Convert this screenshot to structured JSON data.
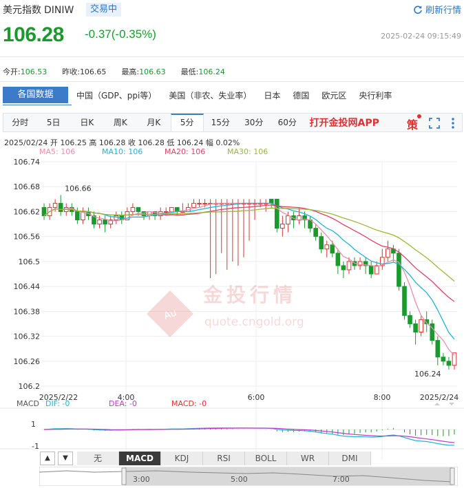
{
  "header": {
    "title": "美元指数",
    "code": "DINIW",
    "status_badge": "交易中",
    "refresh_label": "刷新行情",
    "price": "106.28",
    "change": "-0.37(-0.35%)",
    "timestamp": "2025-02-24 09:15:49"
  },
  "stats": [
    {
      "label": "今开:",
      "value": "106.53",
      "color": "g"
    },
    {
      "label": "昨收:",
      "value": "106.65",
      "color": ""
    },
    {
      "label": "最高:",
      "value": "106.63",
      "color": "g"
    },
    {
      "label": "最低:",
      "value": "106.24",
      "color": "g"
    }
  ],
  "data_tabs": {
    "active": "各国数据",
    "items": [
      "中国（GDP、ppi等）",
      "美国（非农、失业率）",
      "日本",
      "德国",
      "欧元区",
      "央行利率"
    ]
  },
  "periods": [
    "分时",
    "5日",
    "日K",
    "周K",
    "月K",
    "5分",
    "15分",
    "30分",
    "60分"
  ],
  "active_period": "5分",
  "app_link": "打开金投网APP",
  "ohlc_line": "2025/02/24  开 106.25  高 106.28  收 106.28  低 106.24  幅 0.02%",
  "ma_labels": [
    {
      "text": "MA5: 106",
      "color": "#f08cac"
    },
    {
      "text": "MA10: 106",
      "color": "#1fb4d6"
    },
    {
      "text": "MA20: 106",
      "color": "#e0406a"
    },
    {
      "text": "MA30: 106",
      "color": "#99b83a"
    }
  ],
  "watermark": {
    "brand": "金投行情",
    "url": "quote.cngold.org",
    "logo": "Au"
  },
  "macd_line": {
    "label": "MACD",
    "dif": "DIF: -0",
    "dea": "DEA: -0",
    "macd": "MACD: -0"
  },
  "indicator_tabs": [
    "无",
    "MACD",
    "KDJ",
    "RSI",
    "BOLL",
    "WR",
    "DMI"
  ],
  "active_indicator": "MACD",
  "navigator_times": [
    "3:00",
    "5:00",
    "7:00"
  ],
  "colors": {
    "up": "#e03030",
    "down": "#1a9a2e",
    "accent": "#3b7bc9"
  },
  "chart_data": {
    "type": "candlestick",
    "y_ticks": [
      "106.74",
      "106.68",
      "106.62",
      "106.56",
      "106.5",
      "106.44",
      "106.38",
      "106.32",
      "106.26",
      "106.2"
    ],
    "ylim": [
      106.2,
      106.74
    ],
    "x_tick_labels": [
      "2025/2/22",
      "4:00",
      "6:00",
      "8:00",
      "2025/2/24"
    ],
    "annotations": {
      "high": "106.66",
      "low": "106.24"
    },
    "candles": [
      [
        106.63,
        106.61,
        106.64,
        106.6
      ],
      [
        106.61,
        106.63,
        106.64,
        106.6
      ],
      [
        106.63,
        106.64,
        106.65,
        106.62
      ],
      [
        106.64,
        106.62,
        106.66,
        106.61
      ],
      [
        106.62,
        106.63,
        106.64,
        106.61
      ],
      [
        106.63,
        106.62,
        106.64,
        106.61
      ],
      [
        106.62,
        106.6,
        106.63,
        106.59
      ],
      [
        106.6,
        106.62,
        106.63,
        106.59
      ],
      [
        106.62,
        106.61,
        106.63,
        106.6
      ],
      [
        106.61,
        106.59,
        106.62,
        106.58
      ],
      [
        106.59,
        106.6,
        106.61,
        106.58
      ],
      [
        106.6,
        106.59,
        106.61,
        106.57
      ],
      [
        106.59,
        106.6,
        106.61,
        106.58
      ],
      [
        106.6,
        106.61,
        106.62,
        106.59
      ],
      [
        106.61,
        106.6,
        106.62,
        106.59
      ],
      [
        106.6,
        106.62,
        106.63,
        106.6
      ],
      [
        106.62,
        106.63,
        106.64,
        106.61
      ],
      [
        106.63,
        106.62,
        106.63,
        106.61
      ],
      [
        106.62,
        106.61,
        106.62,
        106.6
      ],
      [
        106.61,
        106.62,
        106.62,
        106.6
      ],
      [
        106.62,
        106.61,
        106.62,
        106.6
      ],
      [
        106.61,
        106.62,
        106.63,
        106.6
      ],
      [
        106.62,
        106.62,
        106.63,
        106.61
      ],
      [
        106.62,
        106.63,
        106.63,
        106.62
      ],
      [
        106.63,
        106.62,
        106.63,
        106.61
      ],
      [
        106.62,
        106.62,
        106.64,
        106.62
      ],
      [
        106.62,
        106.63,
        106.64,
        106.62
      ],
      [
        106.63,
        106.64,
        106.65,
        106.63
      ],
      [
        106.64,
        106.64,
        106.65,
        106.63
      ],
      [
        106.64,
        106.64,
        106.65,
        106.63
      ],
      [
        106.64,
        106.64,
        106.65,
        106.46
      ],
      [
        106.64,
        106.64,
        106.65,
        106.47
      ],
      [
        106.64,
        106.64,
        106.65,
        106.52
      ],
      [
        106.64,
        106.64,
        106.65,
        106.48
      ],
      [
        106.64,
        106.64,
        106.65,
        106.5
      ],
      [
        106.64,
        106.64,
        106.65,
        106.49
      ],
      [
        106.64,
        106.64,
        106.65,
        106.51
      ],
      [
        106.64,
        106.64,
        106.65,
        106.55
      ],
      [
        106.64,
        106.64,
        106.65,
        106.6
      ],
      [
        106.64,
        106.64,
        106.65,
        106.63
      ],
      [
        106.64,
        106.64,
        106.65,
        106.62
      ],
      [
        106.65,
        106.64,
        106.65,
        106.63
      ],
      [
        106.65,
        106.58,
        106.65,
        106.57
      ],
      [
        106.58,
        106.59,
        106.61,
        106.56
      ],
      [
        106.59,
        106.61,
        106.62,
        106.57
      ],
      [
        106.61,
        106.6,
        106.62,
        106.58
      ],
      [
        106.6,
        106.61,
        106.63,
        106.59
      ],
      [
        106.61,
        106.6,
        106.62,
        106.58
      ],
      [
        106.6,
        106.58,
        106.61,
        106.57
      ],
      [
        106.58,
        106.56,
        106.59,
        106.55
      ],
      [
        106.56,
        106.53,
        106.57,
        106.52
      ],
      [
        106.53,
        106.54,
        106.55,
        106.51
      ],
      [
        106.54,
        106.52,
        106.55,
        106.51
      ],
      [
        106.52,
        106.49,
        106.53,
        106.47
      ],
      [
        106.49,
        106.48,
        106.5,
        106.46
      ],
      [
        106.48,
        106.5,
        106.51,
        106.47
      ],
      [
        106.5,
        106.49,
        106.51,
        106.48
      ],
      [
        106.49,
        106.5,
        106.51,
        106.48
      ],
      [
        106.5,
        106.49,
        106.51,
        106.47
      ],
      [
        106.49,
        106.47,
        106.5,
        106.46
      ],
      [
        106.47,
        106.49,
        106.5,
        106.47
      ],
      [
        106.49,
        106.51,
        106.53,
        106.48
      ],
      [
        106.51,
        106.53,
        106.55,
        106.5
      ],
      [
        106.53,
        106.52,
        106.54,
        106.5
      ],
      [
        106.52,
        106.44,
        106.53,
        106.43
      ],
      [
        106.44,
        106.37,
        106.45,
        106.36
      ],
      [
        106.37,
        106.35,
        106.38,
        106.34
      ],
      [
        106.35,
        106.33,
        106.36,
        106.3
      ],
      [
        106.33,
        106.36,
        106.37,
        106.32
      ],
      [
        106.36,
        106.35,
        106.38,
        106.33
      ],
      [
        106.35,
        106.31,
        106.36,
        106.3
      ],
      [
        106.31,
        106.27,
        106.32,
        106.25
      ],
      [
        106.27,
        106.26,
        106.28,
        106.25
      ],
      [
        106.26,
        106.25,
        106.27,
        106.24
      ],
      [
        106.25,
        106.28,
        106.28,
        106.24
      ]
    ]
  }
}
